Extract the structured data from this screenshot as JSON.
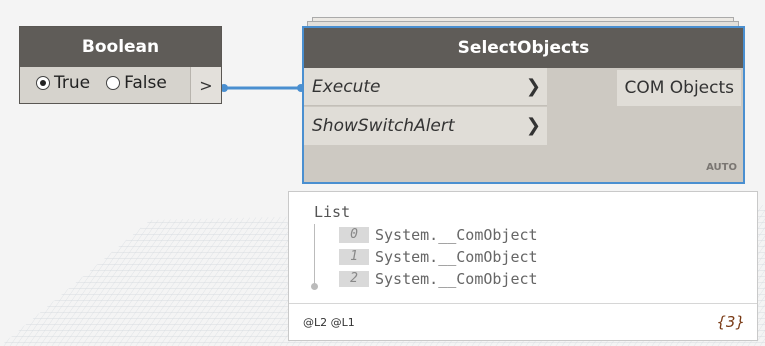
{
  "boolean_node": {
    "title": "Boolean",
    "options": [
      {
        "label": "True",
        "selected": true
      },
      {
        "label": "False",
        "selected": false
      }
    ],
    "output_port": ">"
  },
  "select_node": {
    "title": "SelectObjects",
    "inputs": [
      {
        "label": "Execute",
        "arrow": "❯"
      },
      {
        "label": "ShowSwitchAlert",
        "arrow": "❯"
      }
    ],
    "output": "COM Objects",
    "run_mode": "AUTO",
    "accent": "#4a8fd0"
  },
  "preview": {
    "header": "List",
    "items": [
      {
        "index": "0",
        "value": "System.__ComObject"
      },
      {
        "index": "1",
        "value": "System.__ComObject"
      },
      {
        "index": "2",
        "value": "System.__ComObject"
      }
    ],
    "levels": "@L2 @L1",
    "count": "{3}"
  }
}
